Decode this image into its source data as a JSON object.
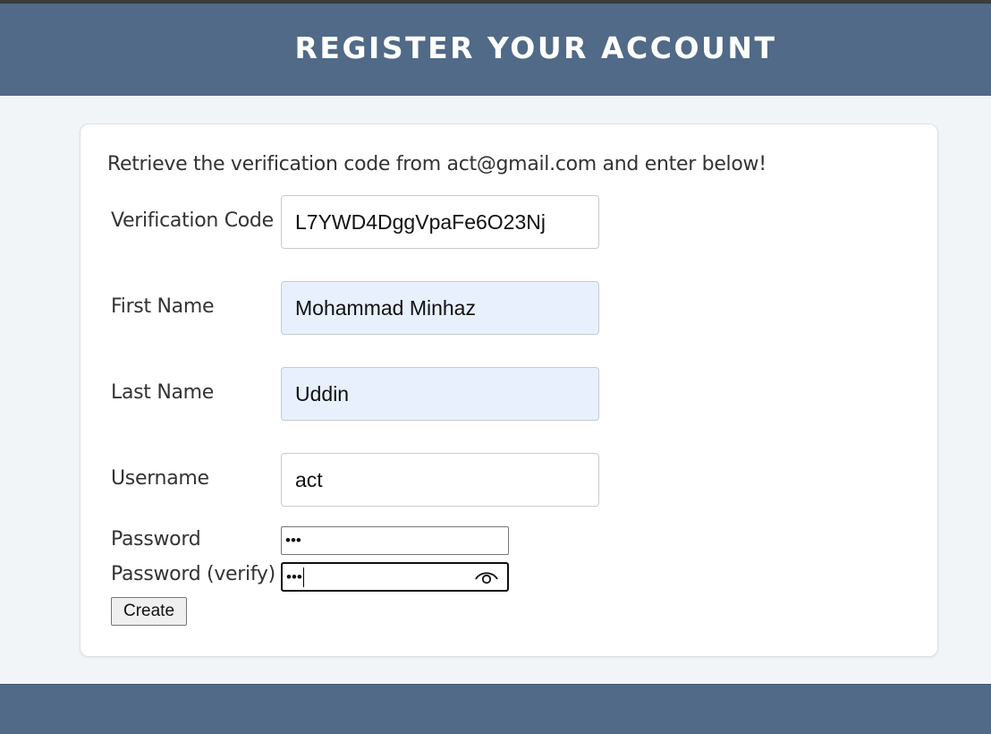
{
  "header": {
    "title": "REGISTER YOUR ACCOUNT"
  },
  "form": {
    "instruction": "Retrieve the verification code from act@gmail.com and enter below!",
    "verification_code": {
      "label": "Verification Code",
      "value": "L7YWD4DggVpaFe6O23Nj"
    },
    "first_name": {
      "label": "First Name",
      "value": "Mohammad Minhaz"
    },
    "last_name": {
      "label": "Last Name",
      "value": "Uddin"
    },
    "username": {
      "label": "Username",
      "value": "act"
    },
    "password": {
      "label": "Password",
      "masked_value": "•••"
    },
    "password_verify": {
      "label": "Password (verify)",
      "masked_value": "•••"
    },
    "create_label": "Create"
  },
  "icons": {
    "reveal_password": "eye-icon"
  },
  "colors": {
    "header_bg": "#506a87",
    "page_bg": "#f2f5f8",
    "autofill_bg": "#e8f0fe"
  }
}
